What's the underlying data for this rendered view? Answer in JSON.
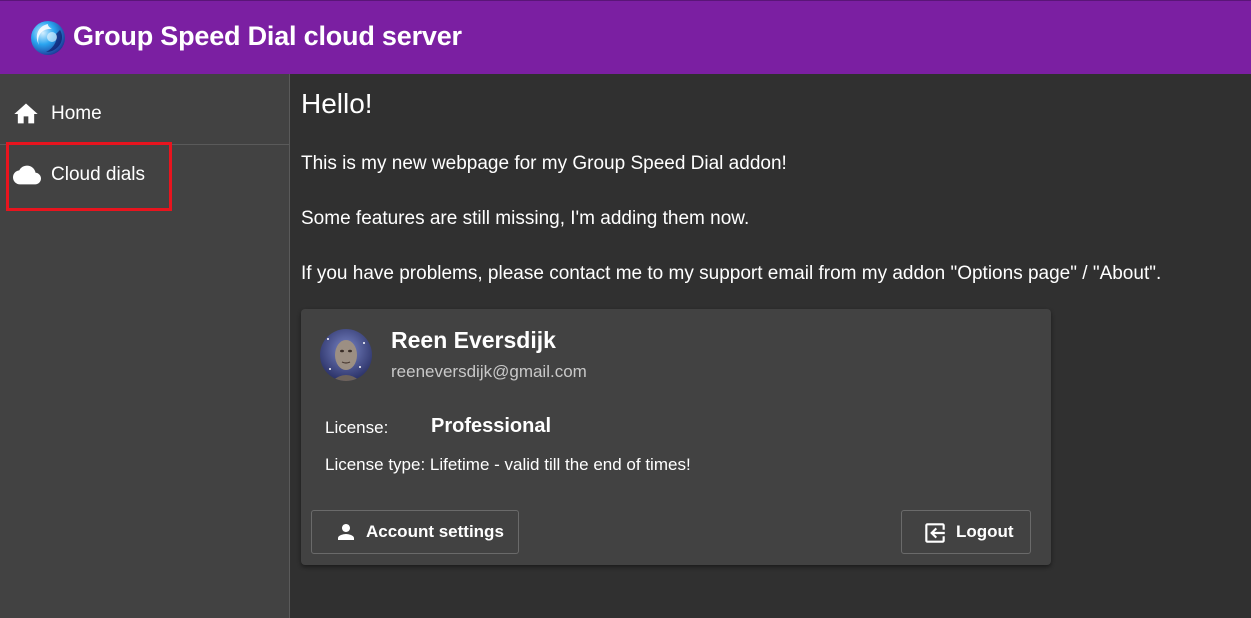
{
  "header": {
    "app_title": "Group Speed Dial cloud server",
    "logo_icon": "group-speed-dial-logo",
    "background": "#7b1fa2"
  },
  "sidebar": {
    "items": [
      {
        "label": "Home",
        "icon": "home-icon"
      },
      {
        "label": "Cloud dials",
        "icon": "cloud-icon",
        "highlighted": true
      }
    ],
    "highlight_color": "#e8141e"
  },
  "main": {
    "heading": "Hello!",
    "paragraphs": [
      "This is my new webpage for my Group Speed Dial addon!",
      "Some features are still missing, I'm adding them now.",
      "If you have problems, please contact me to my support email from my addon \"Options page\" / \"About\"."
    ]
  },
  "account_card": {
    "avatar_icon": "user-avatar",
    "name": "Reen Eversdijk",
    "email": "reeneversdijk@gmail.com",
    "license_label": "License:",
    "license_value": "Professional",
    "license_type": "License type: Lifetime - valid till the end of times!",
    "account_settings_label": "Account settings",
    "account_settings_icon": "person-icon",
    "logout_label": "Logout",
    "logout_icon": "logout-icon"
  }
}
